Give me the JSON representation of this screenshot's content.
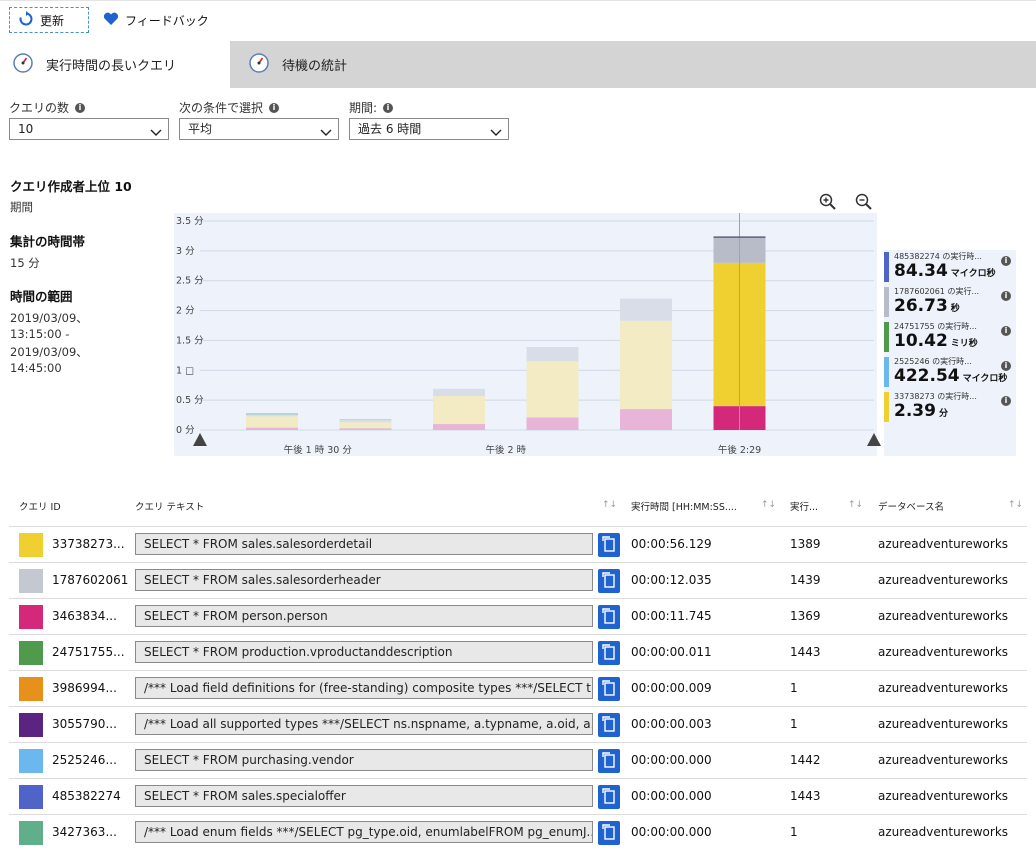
{
  "toolbar": {
    "refresh_label": "更新",
    "feedback_label": "フィードバック"
  },
  "tabs": [
    {
      "label": "実行時間の長いクエリ",
      "active": true
    },
    {
      "label": "待機の統計",
      "active": false
    }
  ],
  "filters": {
    "count": {
      "label": "クエリの数",
      "value": "10"
    },
    "select_by": {
      "label": "次の条件で選択",
      "value": "平均"
    },
    "period": {
      "label": "期間:",
      "value": "過去 6 時間"
    }
  },
  "summary": {
    "title": "クエリ作成者上位 10",
    "period_label": "期間",
    "aggregation_label": "集計の時間帯",
    "aggregation_value": "15 分",
    "range_label": "時間の範囲",
    "range_lines": [
      "2019/03/09、",
      "13:15:00 -",
      "2019/03/09、",
      "14:45:00"
    ]
  },
  "chart_data": {
    "type": "bar",
    "stacked": true,
    "y_ticks": [
      "0 分",
      "0.5 分",
      "1 □",
      "1.5 分",
      "2 分",
      "2.5 分",
      "3 分",
      "3.5 分"
    ],
    "y_tick_values": [
      0,
      0.5,
      1,
      1.5,
      2,
      2.5,
      3,
      3.5
    ],
    "ylim": [
      0,
      3.5
    ],
    "x_labels": [
      {
        "label": "午後 1 時 30 分",
        "after_bar": 1
      },
      {
        "label": "午後 2 時",
        "after_bar": 3
      },
      {
        "label": "午後 2:29",
        "after_bar": 5
      }
    ],
    "series_colors": {
      "pink": "#e8b4d8",
      "cream": "#f2ebc3",
      "gray": "#d8dde8",
      "yellow": "#f0d030",
      "magenta": "#d4297a",
      "slate": "#b7bcc8",
      "teal": "#9ec9c4"
    },
    "bars": [
      {
        "segments": [
          {
            "color": "pink",
            "value": 0.04
          },
          {
            "color": "cream",
            "value": 0.19
          },
          {
            "color": "gray",
            "value": 0.03
          },
          {
            "color": "teal",
            "value": 0.02
          }
        ]
      },
      {
        "segments": [
          {
            "color": "pink",
            "value": 0.03
          },
          {
            "color": "cream",
            "value": 0.1
          },
          {
            "color": "gray",
            "value": 0.04
          },
          {
            "color": "teal",
            "value": 0.01
          }
        ]
      },
      {
        "segments": [
          {
            "color": "pink",
            "value": 0.1
          },
          {
            "color": "cream",
            "value": 0.47
          },
          {
            "color": "gray",
            "value": 0.12
          }
        ]
      },
      {
        "segments": [
          {
            "color": "pink",
            "value": 0.21
          },
          {
            "color": "cream",
            "value": 0.94
          },
          {
            "color": "gray",
            "value": 0.24
          }
        ]
      },
      {
        "segments": [
          {
            "color": "pink",
            "value": 0.35
          },
          {
            "color": "cream",
            "value": 1.48
          },
          {
            "color": "gray",
            "value": 0.37
          }
        ]
      },
      {
        "segments": [
          {
            "color": "magenta",
            "value": 0.4
          },
          {
            "color": "yellow",
            "value": 2.4
          },
          {
            "color": "slate",
            "value": 0.43
          }
        ]
      }
    ],
    "hover_bar": 5,
    "legend": [
      {
        "name": "485382274 の実行時...",
        "value": "84.34",
        "unit": "マイクロ秒",
        "color": "#4f63c8"
      },
      {
        "name": "1787602061 の実行...",
        "value": "26.73",
        "unit": "秒",
        "color": "#b7bcc8"
      },
      {
        "name": "24751755 の実行時...",
        "value": "10.42",
        "unit": "ミリ秒",
        "color": "#4f9a4c"
      },
      {
        "name": "2525246 の実行時...",
        "value": "422.54",
        "unit": "マイクロ秒",
        "color": "#6bb8ee"
      },
      {
        "name": "33738273 の実行時...",
        "value": "2.39",
        "unit": "分",
        "color": "#f0d030"
      }
    ]
  },
  "table": {
    "headers": {
      "query_id": "クエリ ID",
      "query_text": "クエリ テキスト",
      "duration": "実行時間 [HH:MM:SS....",
      "count": "実行...",
      "database": "データベース名"
    },
    "rows": [
      {
        "color": "#f0d030",
        "id": "33738273...",
        "text": "SELECT * FROM sales.salesorderdetail",
        "duration": "00:00:56.129",
        "count": "1389",
        "db": "azureadventureworks"
      },
      {
        "color": "#c4c8d0",
        "id": "1787602061",
        "text": "SELECT * FROM sales.salesorderheader",
        "duration": "00:00:12.035",
        "count": "1439",
        "db": "azureadventureworks"
      },
      {
        "color": "#d4297a",
        "id": "3463834...",
        "text": "SELECT * FROM person.person",
        "duration": "00:00:11.745",
        "count": "1369",
        "db": "azureadventureworks"
      },
      {
        "color": "#4f9a4c",
        "id": "24751755...",
        "text": "SELECT * FROM production.vproductanddescription",
        "duration": "00:00:00.011",
        "count": "1443",
        "db": "azureadventureworks"
      },
      {
        "color": "#e8901c",
        "id": "3986994...",
        "text": "/*** Load field definitions for (free-standing) composite types ***/SELECT t...",
        "duration": "00:00:00.009",
        "count": "1",
        "db": "azureadventureworks"
      },
      {
        "color": "#5a2480",
        "id": "3055790...",
        "text": "/*** Load all supported types ***/SELECT ns.nspname, a.typname, a.oid, a.t...",
        "duration": "00:00:00.003",
        "count": "1",
        "db": "azureadventureworks"
      },
      {
        "color": "#6bb8ee",
        "id": "2525246...",
        "text": "SELECT * FROM purchasing.vendor",
        "duration": "00:00:00.000",
        "count": "1442",
        "db": "azureadventureworks"
      },
      {
        "color": "#4f63c8",
        "id": "485382274",
        "text": "SELECT * FROM sales.specialoffer",
        "duration": "00:00:00.000",
        "count": "1443",
        "db": "azureadventureworks"
      },
      {
        "color": "#5fb08a",
        "id": "3427363...",
        "text": "/*** Load enum fields ***/SELECT pg_type.oid, enumlabelFROM pg_enumJ...",
        "duration": "00:00:00.000",
        "count": "1",
        "db": "azureadventureworks"
      }
    ]
  }
}
